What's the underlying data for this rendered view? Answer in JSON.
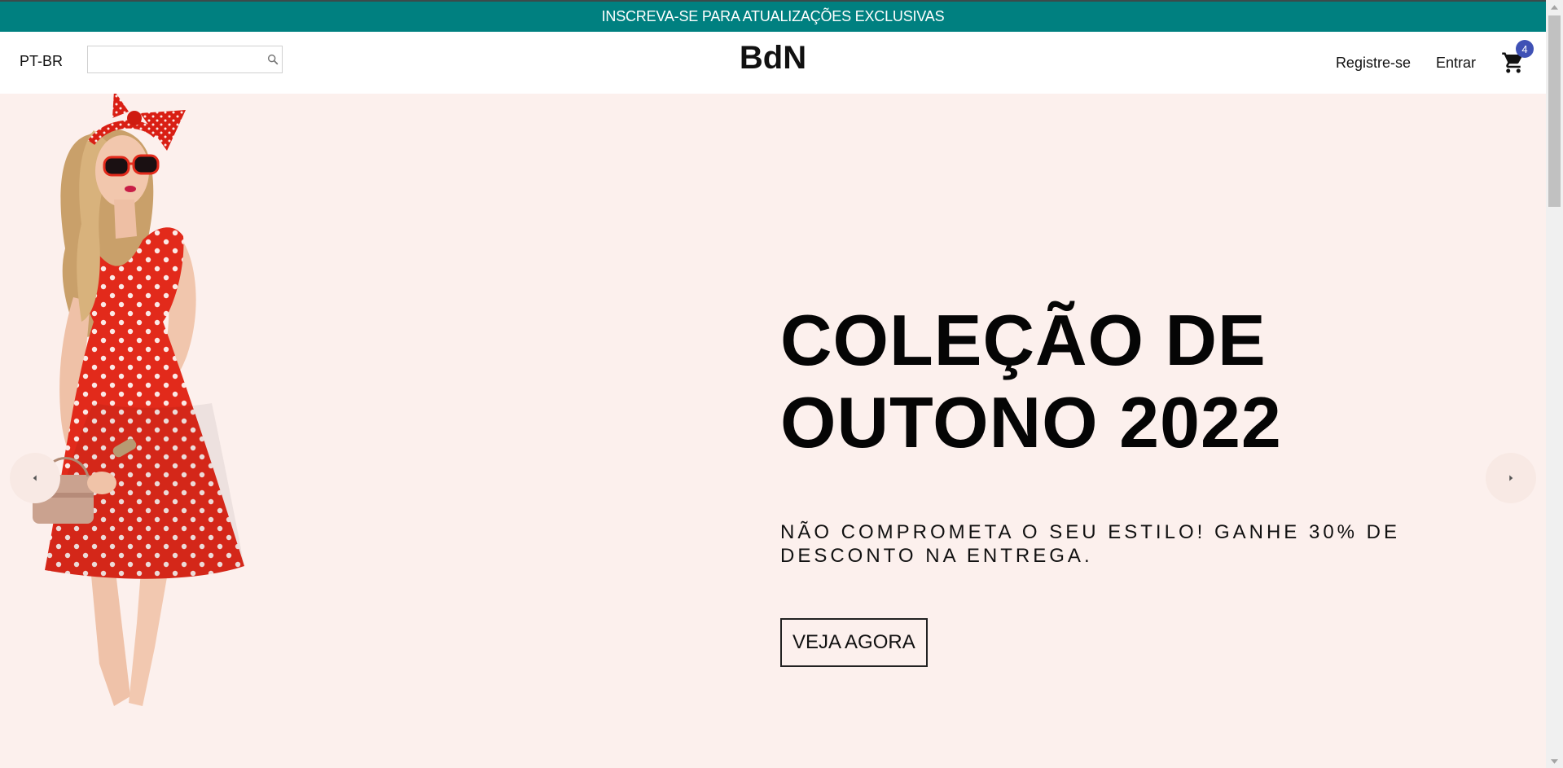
{
  "colors": {
    "announcement_bg": "#008080",
    "hero_bg": "#fcf0ed",
    "cart_badge_bg": "#3f51b5",
    "dress_red": "#e22a1b"
  },
  "announcement": {
    "text": "INSCREVA-SE PARA ATUALIZAÇÕES EXCLUSIVAS"
  },
  "navbar": {
    "language": "PT-BR",
    "search": {
      "value": "",
      "placeholder": "",
      "icon": "search-icon"
    },
    "logo": "BdN",
    "register_label": "Registre-se",
    "login_label": "Entrar",
    "cart": {
      "icon": "shopping-cart-icon",
      "count": "4"
    }
  },
  "hero": {
    "title_line1": "COLEÇÃO DE",
    "title_line2": "OUTONO 2022",
    "subtitle_line1": "NÃO COMPROMETA O SEU ESTILO! GANHE 30% DE",
    "subtitle_line2": "DESCONTO NA ENTREGA.",
    "button_label": "VEJA AGORA",
    "prev_icon": "arrow-left-icon",
    "next_icon": "arrow-right-icon"
  }
}
